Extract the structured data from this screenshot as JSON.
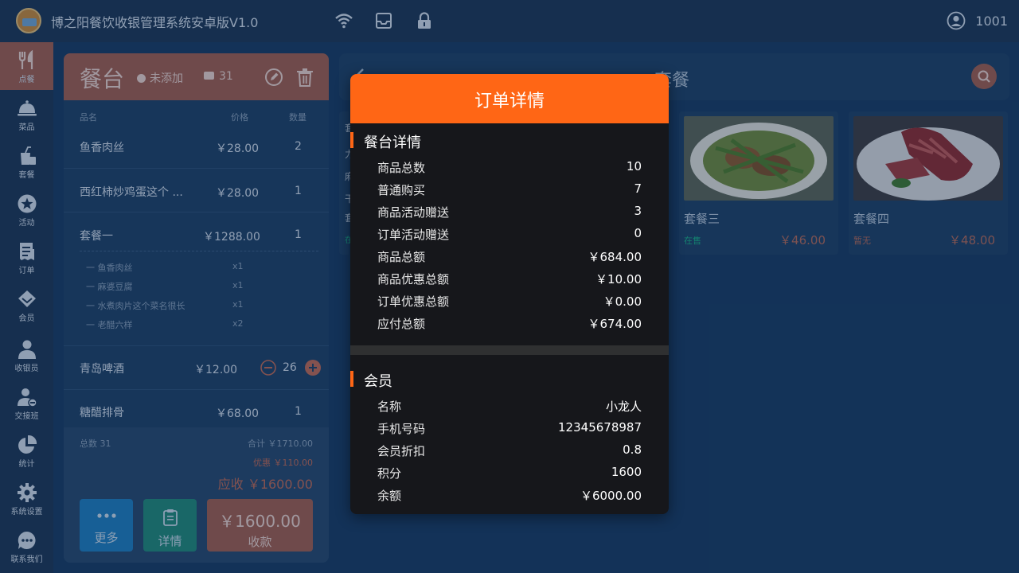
{
  "app": {
    "title": "博之阳餐饮收银管理系统安卓版V1.0",
    "user_id": "1001"
  },
  "sidebar": {
    "items": [
      {
        "label": "点餐",
        "icon": "fork-knife-icon",
        "active": true
      },
      {
        "label": "菜品",
        "icon": "cloche-icon"
      },
      {
        "label": "套餐",
        "icon": "combo-icon"
      },
      {
        "label": "活动",
        "icon": "star-icon"
      },
      {
        "label": "订单",
        "icon": "receipt-icon"
      },
      {
        "label": "会员",
        "icon": "diamond-icon"
      },
      {
        "label": "收银员",
        "icon": "user-icon"
      },
      {
        "label": "交接班",
        "icon": "user-shift-icon"
      },
      {
        "label": "统计",
        "icon": "pie-chart-icon"
      },
      {
        "label": "系统设置",
        "icon": "gear-icon"
      },
      {
        "label": "联系我们",
        "icon": "chat-icon"
      }
    ]
  },
  "order": {
    "title": "餐台",
    "member_status": "未添加",
    "table_count": "31",
    "col_name": "品名",
    "col_price": "价格",
    "col_qty": "数量",
    "rows": [
      {
        "name": "鱼香肉丝",
        "price": "￥28.00",
        "qty": "2"
      },
      {
        "name": "西红柿炒鸡蛋这个 ...",
        "price": "￥28.00",
        "qty": "1"
      },
      {
        "name": "套餐一",
        "price": "￥1288.00",
        "qty": "1"
      },
      {
        "name": "青岛啤酒",
        "price": "￥12.00",
        "qty": "26"
      },
      {
        "name": "糖醋排骨",
        "price": "￥68.00",
        "qty": "1"
      }
    ],
    "combo_items": [
      {
        "name": "一  鱼香肉丝",
        "qty": "x1"
      },
      {
        "name": "一  麻婆豆腐",
        "qty": "x1"
      },
      {
        "name": "一  水煮肉片这个菜名很长",
        "qty": "x1"
      },
      {
        "name": "一  老醋六样",
        "qty": "x2"
      }
    ],
    "total_count": "总数 31",
    "sum": "合计 ￥1710.00",
    "discount": "优惠 ￥110.00",
    "payable": "应收 ￥1600.00",
    "btn_more": "更多",
    "btn_detail": "详情",
    "btn_pay_amount": "￥1600.00",
    "btn_pay_label": "收款"
  },
  "catalog": {
    "title": "套餐",
    "left_fragments": [
      "套",
      "力",
      "麻",
      "干",
      "套",
      "在"
    ],
    "cards": [
      {
        "name": "套餐三",
        "status": "在售",
        "status_color": "#18b487",
        "price": "￥46.00"
      },
      {
        "name": "套餐四",
        "status": "暂无",
        "status_color": "#b86a58",
        "price": "￥48.00"
      }
    ]
  },
  "modal": {
    "title": "订单详情",
    "table_section": "餐台详情",
    "table_rows": [
      {
        "k": "商品总数",
        "v": "10"
      },
      {
        "k": "普通购买",
        "v": "7"
      },
      {
        "k": "商品活动赠送",
        "v": "3"
      },
      {
        "k": "订单活动赠送",
        "v": "0"
      },
      {
        "k": "商品总额",
        "v": "￥684.00"
      },
      {
        "k": "商品优惠总额",
        "v": "￥10.00"
      },
      {
        "k": "订单优惠总额",
        "v": "￥0.00"
      },
      {
        "k": "应付总额",
        "v": "￥674.00"
      }
    ],
    "member_section": "会员",
    "member_rows": [
      {
        "k": "名称",
        "v": "小龙人"
      },
      {
        "k": "手机号码",
        "v": "12345678987"
      },
      {
        "k": "会员折扣",
        "v": "0.8"
      },
      {
        "k": "积分",
        "v": "1600"
      },
      {
        "k": "余额",
        "v": "￥6000.00"
      }
    ]
  },
  "colors": {
    "accent": "#ff6615",
    "brand": "#a45f4f",
    "bg": "#163a63"
  }
}
